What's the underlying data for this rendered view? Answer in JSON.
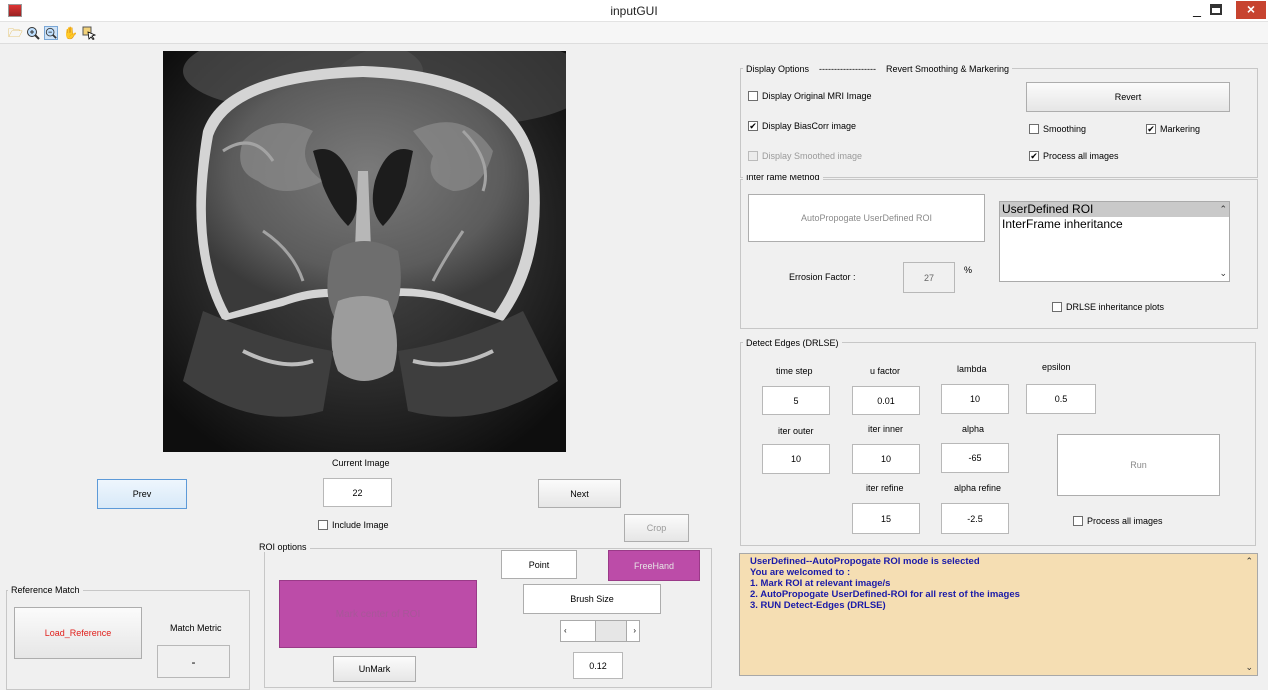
{
  "window": {
    "title": "inputGUI",
    "minimize": "_",
    "close": "×"
  },
  "toolbar": {
    "icons": [
      "open-folder-icon",
      "zoom-in-icon",
      "zoom-out-icon",
      "pan-hand-icon",
      "data-cursor-icon"
    ]
  },
  "navigation": {
    "prev_label": "Prev",
    "next_label": "Next",
    "current_image_label": "Current Image",
    "current_image_value": "22",
    "include_image_label": "Include Image",
    "include_image_checked": false,
    "crop_label": "Crop"
  },
  "roi_options": {
    "title": "ROI options",
    "point_label": "Point",
    "freehand_label": "FreeHand",
    "mark_center_label": "Mark center of ROI",
    "brush_size_label": "Brush Size",
    "unmark_label": "UnMark",
    "brush_value": "0.12"
  },
  "reference_match": {
    "title": "Reference Match",
    "load_reference_label": "Load_Reference",
    "match_metric_label": "Match Metric",
    "match_metric_value": "-"
  },
  "display_options": {
    "title": "Display Options",
    "separator": "-------------------",
    "revert_title": "Revert  Smoothing & Markering",
    "original_mri": {
      "label": "Display Original MRI Image",
      "checked": false
    },
    "biascorr": {
      "label": "Display BiasCorr image",
      "checked": true
    },
    "smoothed": {
      "label": "Display Smoothed image",
      "checked": false
    },
    "revert_label": "Revert",
    "smoothing": {
      "label": "Smoothing",
      "checked": false
    },
    "markering": {
      "label": "Markering",
      "checked": true
    },
    "process_all": {
      "label": "Process all images",
      "checked": true
    }
  },
  "interframe": {
    "title": "Inter rame Method",
    "autopropogate_label": "AutoPropogate UserDefined ROI",
    "erosion_label": "Errosion Factor :",
    "erosion_value": "27",
    "erosion_unit": "%",
    "list_items": [
      "UserDefined ROI",
      "InterFrame inheritance"
    ],
    "selected_index": 0,
    "drlse_plots": {
      "label": "DRLSE inheritance plots",
      "checked": false
    }
  },
  "detect_edges": {
    "title": "Detect Edges (DRLSE)",
    "time_step": {
      "label": "time step",
      "value": "5"
    },
    "u_factor": {
      "label": "u factor",
      "value": "0.01"
    },
    "lambda": {
      "label": "lambda",
      "value": "10"
    },
    "epsilon": {
      "label": "epsilon",
      "value": "0.5"
    },
    "iter_outer": {
      "label": "iter outer",
      "value": "10"
    },
    "iter_inner": {
      "label": "iter inner",
      "value": "10"
    },
    "alpha": {
      "label": "alpha",
      "value": "-65"
    },
    "iter_refine": {
      "label": "iter refine",
      "value": "15"
    },
    "alpha_refine": {
      "label": "alpha refine",
      "value": "-2.5"
    },
    "run_label": "Run",
    "process_all": {
      "label": "Process all images",
      "checked": false
    }
  },
  "message": {
    "lines": [
      "UserDefined--AutoPropogate ROI mode is selected",
      "You are welcomed to :",
      " 1. Mark ROI at relevant image/s",
      " 2. AutoPropogate UserDefined-ROI for all rest of the images",
      " 3. RUN Detect-Edges (DRLSE)"
    ]
  },
  "colors": {
    "magenta_button": "#bc4ca8",
    "message_bg": "#f5deb3",
    "message_text": "#1a1aa8",
    "close_button": "#c7432f",
    "load_reference_text": "#e0201c"
  }
}
